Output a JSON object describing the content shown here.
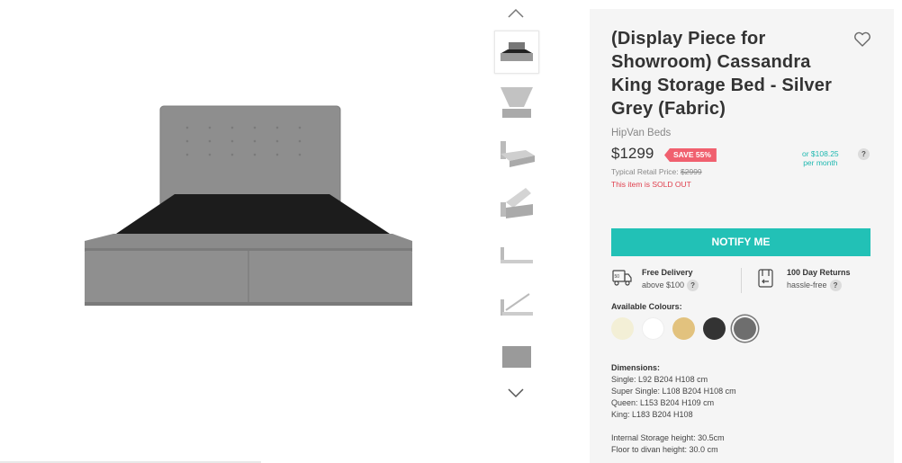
{
  "product": {
    "title": "(Display Piece for Showroom) Cassandra King Storage Bed - Silver Grey (Fabric)",
    "brand": "HipVan Beds",
    "price": "$1299",
    "save_badge": "SAVE 55%",
    "monthly_line1": "or $108.25",
    "monthly_line2": "per month",
    "retail_label": "Typical Retail Price:",
    "retail_price": "$2999",
    "status": "This item is SOLD OUT",
    "notify_label": "NOTIFY ME",
    "help_glyph": "?"
  },
  "features": {
    "delivery_title": "Free Delivery",
    "delivery_sub": "above $100",
    "returns_title": "100 Day Returns",
    "returns_sub": "hassle-free"
  },
  "colours": {
    "label": "Available Colours:",
    "options": [
      "#f3efd6",
      "#ffffff",
      "#e2c27e",
      "#333333",
      "#6e6e6e"
    ],
    "selected_index": 4
  },
  "dimensions": {
    "heading": "Dimensions:",
    "lines": [
      "Single: L92 B204 H108 cm",
      "Super Single: L108 B204 H108 cm",
      "Queen: L153 B204 H109 cm",
      "King: L183 B204 H108"
    ],
    "extra": [
      "Internal Storage height: 30.5cm",
      "Floor to divan height: 30.0 cm"
    ]
  },
  "icons": {
    "wishlist": "heart-outline-icon",
    "up": "chevron-up-icon",
    "down": "chevron-down-icon",
    "delivery": "delivery-truck-icon",
    "returns": "return-box-icon"
  },
  "colors": {
    "accent": "#22c1b6",
    "sale": "#f0606f",
    "soldout": "#e0404e",
    "panel_bg": "#f5f5f5",
    "fabric": "#8a8a8a"
  }
}
